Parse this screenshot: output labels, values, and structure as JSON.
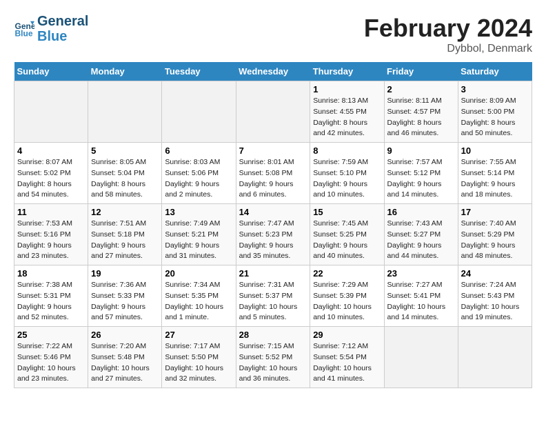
{
  "header": {
    "logo_general": "General",
    "logo_blue": "Blue",
    "title": "February 2024",
    "subtitle": "Dybbol, Denmark"
  },
  "weekdays": [
    "Sunday",
    "Monday",
    "Tuesday",
    "Wednesday",
    "Thursday",
    "Friday",
    "Saturday"
  ],
  "weeks": [
    [
      {
        "day": "",
        "detail": ""
      },
      {
        "day": "",
        "detail": ""
      },
      {
        "day": "",
        "detail": ""
      },
      {
        "day": "",
        "detail": ""
      },
      {
        "day": "1",
        "detail": "Sunrise: 8:13 AM\nSunset: 4:55 PM\nDaylight: 8 hours\nand 42 minutes."
      },
      {
        "day": "2",
        "detail": "Sunrise: 8:11 AM\nSunset: 4:57 PM\nDaylight: 8 hours\nand 46 minutes."
      },
      {
        "day": "3",
        "detail": "Sunrise: 8:09 AM\nSunset: 5:00 PM\nDaylight: 8 hours\nand 50 minutes."
      }
    ],
    [
      {
        "day": "4",
        "detail": "Sunrise: 8:07 AM\nSunset: 5:02 PM\nDaylight: 8 hours\nand 54 minutes."
      },
      {
        "day": "5",
        "detail": "Sunrise: 8:05 AM\nSunset: 5:04 PM\nDaylight: 8 hours\nand 58 minutes."
      },
      {
        "day": "6",
        "detail": "Sunrise: 8:03 AM\nSunset: 5:06 PM\nDaylight: 9 hours\nand 2 minutes."
      },
      {
        "day": "7",
        "detail": "Sunrise: 8:01 AM\nSunset: 5:08 PM\nDaylight: 9 hours\nand 6 minutes."
      },
      {
        "day": "8",
        "detail": "Sunrise: 7:59 AM\nSunset: 5:10 PM\nDaylight: 9 hours\nand 10 minutes."
      },
      {
        "day": "9",
        "detail": "Sunrise: 7:57 AM\nSunset: 5:12 PM\nDaylight: 9 hours\nand 14 minutes."
      },
      {
        "day": "10",
        "detail": "Sunrise: 7:55 AM\nSunset: 5:14 PM\nDaylight: 9 hours\nand 18 minutes."
      }
    ],
    [
      {
        "day": "11",
        "detail": "Sunrise: 7:53 AM\nSunset: 5:16 PM\nDaylight: 9 hours\nand 23 minutes."
      },
      {
        "day": "12",
        "detail": "Sunrise: 7:51 AM\nSunset: 5:18 PM\nDaylight: 9 hours\nand 27 minutes."
      },
      {
        "day": "13",
        "detail": "Sunrise: 7:49 AM\nSunset: 5:21 PM\nDaylight: 9 hours\nand 31 minutes."
      },
      {
        "day": "14",
        "detail": "Sunrise: 7:47 AM\nSunset: 5:23 PM\nDaylight: 9 hours\nand 35 minutes."
      },
      {
        "day": "15",
        "detail": "Sunrise: 7:45 AM\nSunset: 5:25 PM\nDaylight: 9 hours\nand 40 minutes."
      },
      {
        "day": "16",
        "detail": "Sunrise: 7:43 AM\nSunset: 5:27 PM\nDaylight: 9 hours\nand 44 minutes."
      },
      {
        "day": "17",
        "detail": "Sunrise: 7:40 AM\nSunset: 5:29 PM\nDaylight: 9 hours\nand 48 minutes."
      }
    ],
    [
      {
        "day": "18",
        "detail": "Sunrise: 7:38 AM\nSunset: 5:31 PM\nDaylight: 9 hours\nand 52 minutes."
      },
      {
        "day": "19",
        "detail": "Sunrise: 7:36 AM\nSunset: 5:33 PM\nDaylight: 9 hours\nand 57 minutes."
      },
      {
        "day": "20",
        "detail": "Sunrise: 7:34 AM\nSunset: 5:35 PM\nDaylight: 10 hours\nand 1 minute."
      },
      {
        "day": "21",
        "detail": "Sunrise: 7:31 AM\nSunset: 5:37 PM\nDaylight: 10 hours\nand 5 minutes."
      },
      {
        "day": "22",
        "detail": "Sunrise: 7:29 AM\nSunset: 5:39 PM\nDaylight: 10 hours\nand 10 minutes."
      },
      {
        "day": "23",
        "detail": "Sunrise: 7:27 AM\nSunset: 5:41 PM\nDaylight: 10 hours\nand 14 minutes."
      },
      {
        "day": "24",
        "detail": "Sunrise: 7:24 AM\nSunset: 5:43 PM\nDaylight: 10 hours\nand 19 minutes."
      }
    ],
    [
      {
        "day": "25",
        "detail": "Sunrise: 7:22 AM\nSunset: 5:46 PM\nDaylight: 10 hours\nand 23 minutes."
      },
      {
        "day": "26",
        "detail": "Sunrise: 7:20 AM\nSunset: 5:48 PM\nDaylight: 10 hours\nand 27 minutes."
      },
      {
        "day": "27",
        "detail": "Sunrise: 7:17 AM\nSunset: 5:50 PM\nDaylight: 10 hours\nand 32 minutes."
      },
      {
        "day": "28",
        "detail": "Sunrise: 7:15 AM\nSunset: 5:52 PM\nDaylight: 10 hours\nand 36 minutes."
      },
      {
        "day": "29",
        "detail": "Sunrise: 7:12 AM\nSunset: 5:54 PM\nDaylight: 10 hours\nand 41 minutes."
      },
      {
        "day": "",
        "detail": ""
      },
      {
        "day": "",
        "detail": ""
      }
    ]
  ]
}
